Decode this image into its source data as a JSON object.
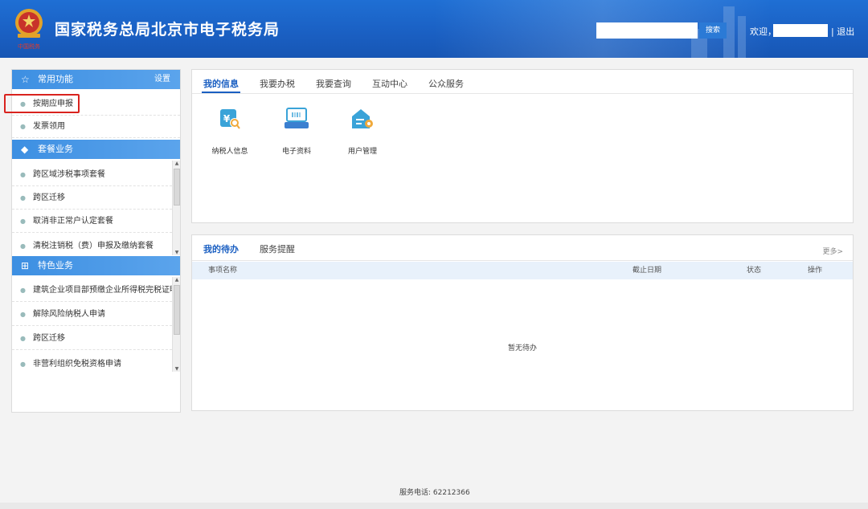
{
  "header": {
    "site_title": "国家税务总局北京市电子税务局",
    "search_placeholder": "",
    "search_button": "搜索",
    "welcome": "欢迎，",
    "logout": "| 退出",
    "logo_caption": "中国税务",
    "brand_color": "#1a5fc2"
  },
  "sidebar": {
    "common": {
      "title": "常用功能",
      "settings": "设置",
      "icon": "star-icon",
      "items": [
        {
          "label": "按期应申报"
        },
        {
          "label": "发票领用"
        }
      ]
    },
    "package": {
      "title": "套餐业务",
      "icon": "layers-icon",
      "items": [
        {
          "label": "跨区域涉税事项套餐"
        },
        {
          "label": "跨区迁移"
        },
        {
          "label": "取消非正常户认定套餐"
        },
        {
          "label": "清税注销税（费）申报及缴纳套餐"
        }
      ]
    },
    "special": {
      "title": "特色业务",
      "icon": "grid-icon",
      "items": [
        {
          "label": "建筑企业项目部预缴企业所得税完税证明..."
        },
        {
          "label": "解除风险纳税人申请"
        },
        {
          "label": "跨区迁移"
        },
        {
          "label": "非营利组织免税资格申请"
        }
      ]
    }
  },
  "info_panel": {
    "tabs": [
      "我的信息",
      "我要办税",
      "我要查询",
      "互动中心",
      "公众服务"
    ],
    "active_tab": "我的信息",
    "apps": [
      {
        "label": "纳税人信息",
        "icon": "taxpayer-info-icon"
      },
      {
        "label": "电子资料",
        "icon": "electronic-data-icon"
      },
      {
        "label": "用户管理",
        "icon": "user-management-icon"
      }
    ]
  },
  "todo_panel": {
    "tabs": [
      "我的待办",
      "服务提醒"
    ],
    "active_tab": "我的待办",
    "more": "更多>",
    "columns": [
      "事项名称",
      "截止日期",
      "状态",
      "操作"
    ],
    "empty_text": "暂无待办"
  },
  "footer": {
    "phone": "服务电话: 62212366"
  }
}
